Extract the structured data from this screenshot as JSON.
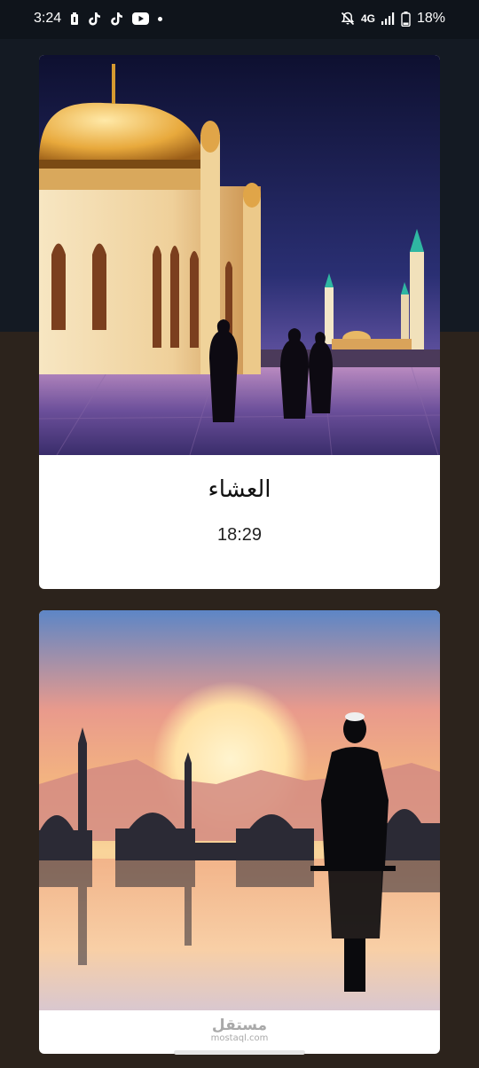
{
  "status_bar": {
    "time": "3:24",
    "network": "4G",
    "battery": "18%"
  },
  "cards": [
    {
      "prayer_name": "العشاء",
      "prayer_time": "18:29",
      "image": "Mosque with golden dome at dusk with silhouettes of worshippers"
    },
    {
      "image": "Silhouette of a man praying facing a sunset over a mosque skyline reflected in water"
    }
  ],
  "watermark": {
    "arabic": "مستقل",
    "latin": "mostaql.com"
  },
  "colors": {
    "top_band": "#141a23",
    "background": "#2c231c",
    "card": "#ffffff"
  }
}
